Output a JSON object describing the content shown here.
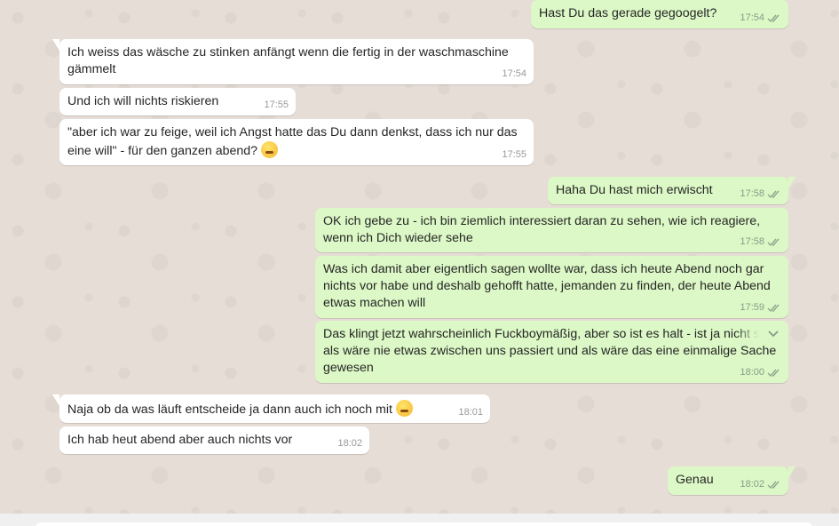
{
  "messages": [
    {
      "dir": "out",
      "text": "Hast Du das gerade gegoogelt?",
      "time": "17:54",
      "ticks": true
    },
    {
      "dir": "in",
      "text": "Ich weiss das wäsche zu stinken anfängt wenn die fertig in der waschmaschine gämmelt",
      "time": "17:54"
    },
    {
      "dir": "in",
      "text": "Und ich will nichts riskieren",
      "time": "17:55"
    },
    {
      "dir": "in",
      "text": "\"aber ich war zu feige, weil ich Angst hatte das Du dann denkst, dass ich nur das eine will\" - für den ganzen abend?",
      "time": "17:55",
      "emoji": "thinking-face"
    },
    {
      "dir": "out",
      "text": "Haha Du hast mich erwischt",
      "time": "17:58",
      "ticks": true
    },
    {
      "dir": "out",
      "text": "OK ich gebe zu - ich bin ziemlich interessiert daran zu sehen, wie ich reagiere, wenn ich Dich wieder sehe",
      "time": "17:58",
      "ticks": true
    },
    {
      "dir": "out",
      "text": "Was ich damit aber eigentlich sagen wollte war, dass ich heute Abend noch gar nichts vor habe und deshalb gehofft hatte, jemanden zu finden, der heute Abend etwas machen will",
      "time": "17:59",
      "ticks": true
    },
    {
      "dir": "out",
      "text": "Das klingt jetzt wahrscheinlich Fuckboymäßig, aber so ist es halt - ist ja nicht so als wäre nie etwas zwischen uns passiert und als wäre das eine einmalige Sache gewesen",
      "time": "18:00",
      "ticks": true
    },
    {
      "dir": "in",
      "text": "Naja ob da was läuft entscheide ja dann auch ich noch mit",
      "time": "18:01",
      "emoji": "grinning-sweat-face"
    },
    {
      "dir": "in",
      "text": "Ich hab heut abend aber auch nichts vor",
      "time": "18:02"
    },
    {
      "dir": "out",
      "text": "Genau",
      "time": "18:02",
      "ticks": true
    }
  ],
  "icons": {
    "ticks": "double-check-icon",
    "menu": "chevron-down-icon"
  },
  "colors": {
    "incoming_bubble": "#ffffff",
    "outgoing_bubble": "#dcf8c6",
    "chat_background": "#e6ded6",
    "ticks": "#92a58c"
  }
}
